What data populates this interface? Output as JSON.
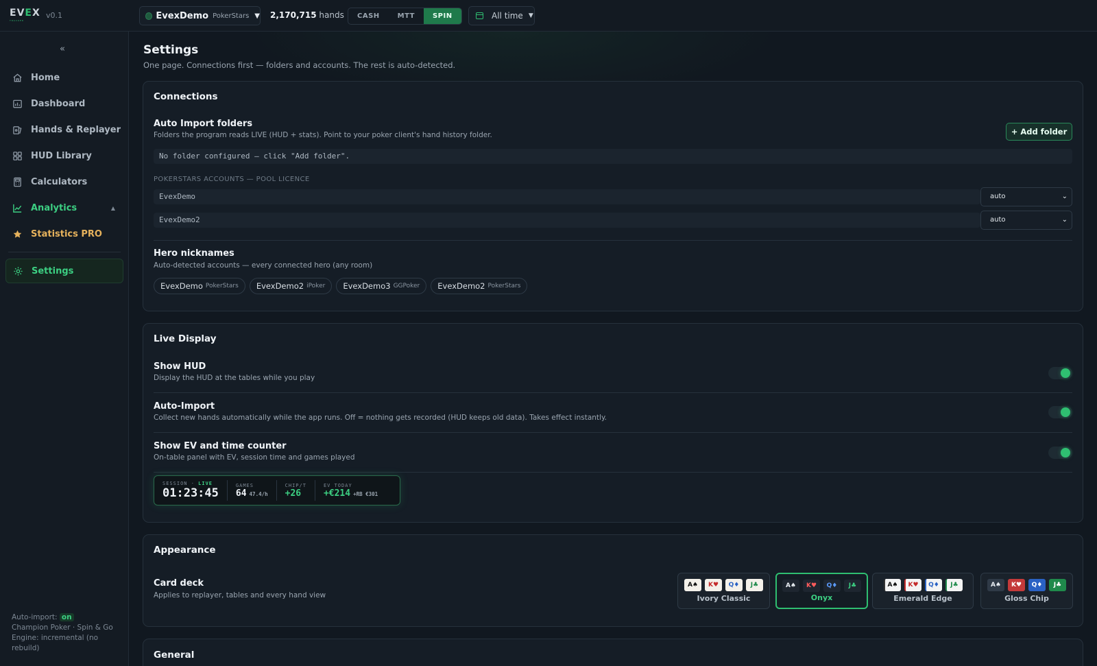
{
  "app": {
    "logo": "EVEX",
    "logo_tagline": "TRACKER",
    "version": "v0.1"
  },
  "topbar": {
    "account": {
      "name": "EvexDemo",
      "room": "PokerStars",
      "caret": "▼"
    },
    "hands": {
      "count": "2,170,715",
      "suffix": "hands"
    },
    "game_types": [
      {
        "label": "CASH",
        "active": false
      },
      {
        "label": "MTT",
        "active": false
      },
      {
        "label": "SPIN",
        "active": true
      }
    ],
    "time_filter": {
      "label": "All time",
      "caret": "▼"
    }
  },
  "sidebar": {
    "collapse_glyph": "«",
    "items": [
      {
        "label": "Home",
        "icon": "home-icon"
      },
      {
        "label": "Dashboard",
        "icon": "dashboard-icon"
      },
      {
        "label": "Hands & Replayer",
        "icon": "hands-icon"
      },
      {
        "label": "HUD Library",
        "icon": "hud-library-icon"
      },
      {
        "label": "Calculators",
        "icon": "calculator-icon"
      },
      {
        "label": "Analytics",
        "icon": "analytics-icon",
        "caret": "▲"
      },
      {
        "label": "Statistics PRO",
        "icon": "star-icon"
      },
      {
        "label": "Settings",
        "icon": "gear-icon",
        "active": true
      }
    ],
    "footer": {
      "auto_import_label": "Auto-import:",
      "auto_import_value": "on",
      "line2": "Champion Poker · Spin & Go",
      "line3": "Engine: incremental (no rebuild)"
    }
  },
  "page": {
    "title": "Settings",
    "subtitle": "One page. Connections first — folders and accounts. The rest is auto-detected."
  },
  "connections": {
    "title": "Connections",
    "auto_import": {
      "title": "Auto Import folders",
      "desc": "Folders the program reads LIVE (HUD + stats). Point to your poker client's hand history folder.",
      "add_button": "+ Add folder",
      "empty_text": "No folder configured — click \"Add folder\"."
    },
    "accounts_label": "POKERSTARS ACCOUNTS — POOL LICENCE",
    "accounts": [
      {
        "name": "EvexDemo",
        "mode": "auto"
      },
      {
        "name": "EvexDemo2",
        "mode": "auto"
      }
    ],
    "hero": {
      "title": "Hero nicknames",
      "desc": "Auto-detected accounts — every connected hero (any room)",
      "chips": [
        {
          "name": "EvexDemo",
          "room": "PokerStars"
        },
        {
          "name": "EvexDemo2",
          "room": "iPoker"
        },
        {
          "name": "EvexDemo3",
          "room": "GGPoker"
        },
        {
          "name": "EvexDemo2",
          "room": "PokerStars"
        }
      ]
    }
  },
  "live_display": {
    "title": "Live Display",
    "toggles": [
      {
        "title": "Show HUD",
        "desc": "Display the HUD at the tables while you play",
        "on": true
      },
      {
        "title": "Auto-Import",
        "desc": "Collect new hands automatically while the app runs. Off = nothing gets recorded (HUD keeps old data). Takes effect instantly.",
        "on": true
      },
      {
        "title": "Show EV and time counter",
        "desc": "On-table panel with EV, session time and games played",
        "on": true
      }
    ],
    "ev_panel": {
      "session_label": "SESSION ·",
      "live_label": "LIVE",
      "session_time": "01:23:45",
      "games_label": "GAMES",
      "games_value": "64",
      "games_rate": "47.4/h",
      "chipt_label": "CHIP/T",
      "chipt_value": "+26",
      "ev_label": "EV TODAY",
      "ev_value": "+€214",
      "ev_rb": "+RB €301"
    }
  },
  "appearance": {
    "title": "Appearance",
    "card_deck": {
      "title": "Card deck",
      "desc": "Applies to replayer, tables and every hand view"
    },
    "decks": [
      {
        "name": "Ivory Classic",
        "selected": false,
        "cards": [
          "A♠",
          "K♥",
          "Q♦",
          "J♣"
        ]
      },
      {
        "name": "Onyx",
        "selected": true,
        "cards": [
          "A♠",
          "K♥",
          "Q♦",
          "J♣"
        ]
      },
      {
        "name": "Emerald Edge",
        "selected": false,
        "cards": [
          "A♠",
          "K♥",
          "Q♦",
          "J♣"
        ]
      },
      {
        "name": "Gloss Chip",
        "selected": false,
        "cards": [
          "A♠",
          "K♥",
          "Q♦",
          "J♣"
        ]
      }
    ]
  },
  "general": {
    "title": "General"
  },
  "colors": {
    "accent": "#2fbf71",
    "background": "#111820",
    "pro": "#e6b25c"
  }
}
